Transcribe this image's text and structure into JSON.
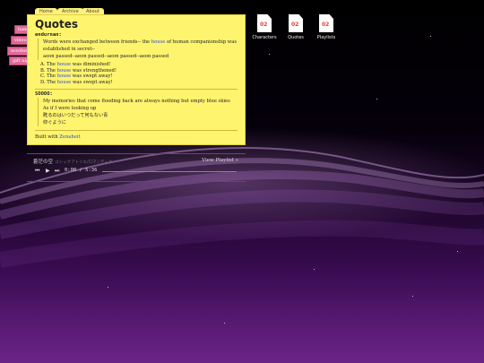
{
  "nav": {
    "tabs": [
      "Home",
      "Archive",
      "About"
    ]
  },
  "side_tags": [
    "band",
    "videos",
    "wordwrap",
    "gift night"
  ],
  "post": {
    "title": "Quotes",
    "q1": {
      "speaker": "endurnan:",
      "line1_pre": "Words were exchanged between friends-- the ",
      "line1_hl": "house",
      "line1_post": " of human companionship was established in secret--",
      "line2": "aeon passed--aeon passed--aeon passed--aeon passed",
      "items": [
        {
          "pre": "A. The ",
          "hl": "house",
          "post": " was diminished!"
        },
        {
          "pre": "B. The ",
          "hl": "house",
          "post": " was strengthened!"
        },
        {
          "pre": "C. The ",
          "hl": "house",
          "post": " was swept away!"
        },
        {
          "pre": "D. The ",
          "hl": "house",
          "post": " was swept away!"
        }
      ]
    },
    "q2": {
      "speaker": "SOOOO:",
      "line1": "My memories that come flooding back are always nothing but empty blue skies",
      "line2": "As if I were looking up",
      "jp1": "甦るのはいつだって何もない青",
      "jp2": "仰ぐように"
    },
    "footer_pre": "Built with ",
    "footer_link": "Zenaheit"
  },
  "player": {
    "song": "蒼茫の空",
    "song_sub": "ゴシックアトリエ/ロマンティク",
    "view_playlist": "View Playlist »",
    "time": "0:00 / 5:36",
    "progress": 0
  },
  "desktop_icons": [
    {
      "label": "Characters",
      "badge": "02"
    },
    {
      "label": "Quotes",
      "badge": "02"
    },
    {
      "label": "Playlists",
      "badge": "02"
    }
  ]
}
